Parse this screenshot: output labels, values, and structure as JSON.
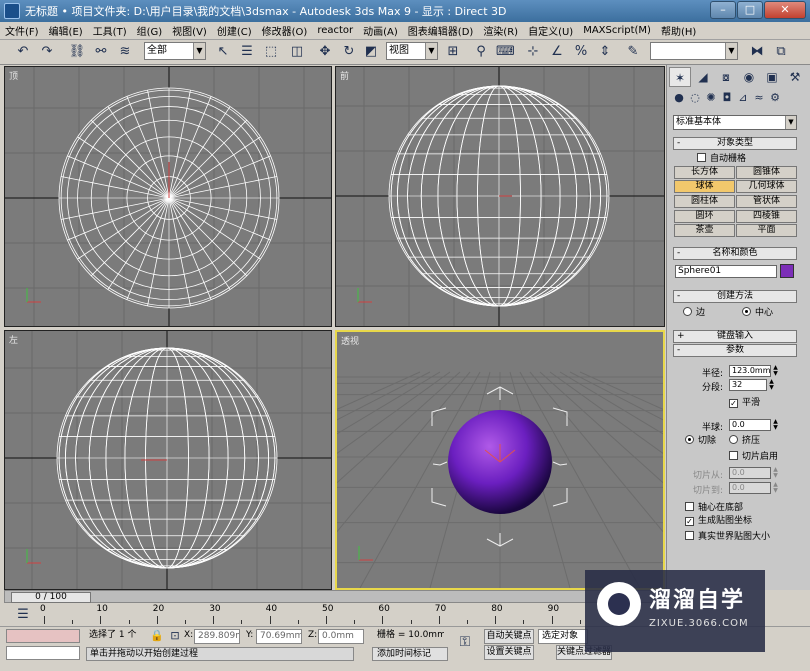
{
  "window": {
    "title": "无标题    • 项目文件夹: D:\\用户目录\\我的文档\\3dsmax    - Autodesk 3ds Max 9    - 显示 : Direct 3D",
    "minimize": "–",
    "maximize": "□",
    "close": "✕"
  },
  "menu": [
    "文件(F)",
    "编辑(E)",
    "工具(T)",
    "组(G)",
    "视图(V)",
    "创建(C)",
    "修改器(O)",
    "reactor",
    "动画(A)",
    "图表编辑器(D)",
    "渲染(R)",
    "自定义(U)",
    "MAXScript(M)",
    "帮助(H)"
  ],
  "toolbar": {
    "selection_filter": "全部",
    "coord_system": "视图",
    "named_selection": ""
  },
  "viewports": {
    "top": "顶",
    "front": "前",
    "left": "左",
    "perspective": "透视"
  },
  "command_panel": {
    "category": "标准基本体",
    "object_type_title": "对象类型",
    "autogrid": "自动栅格",
    "objects": [
      "长方体",
      "圆锥体",
      "球体",
      "几何球体",
      "圆柱体",
      "管状体",
      "圆环",
      "四棱锥",
      "茶壶",
      "平面"
    ],
    "selected_object": "球体",
    "name_color_title": "名称和颜色",
    "object_name": "Sphere01",
    "object_color": "#7c2fb8",
    "creation_method_title": "创建方法",
    "creation_edge": "边",
    "creation_center": "中心",
    "keyboard_entry_title": "键盘输入",
    "parameters_title": "参数",
    "radius_label": "半径:",
    "radius_value": "123.0mm",
    "segments_label": "分段:",
    "segments_value": "32",
    "smooth_label": "平滑",
    "hemisphere_label": "半球:",
    "hemisphere_value": "0.0",
    "chop_label": "切除",
    "squash_label": "挤压",
    "slice_on_label": "切片启用",
    "slice_from_label": "切片从:",
    "slice_from_value": "0.0",
    "slice_to_label": "切片到:",
    "slice_to_value": "0.0",
    "base_to_pivot_label": "轴心在底部",
    "gen_mapping_label": "生成贴图坐标",
    "real_world_label": "真实世界贴图大小"
  },
  "timeline": {
    "frame_display": "0 / 100",
    "ticks": [
      "0",
      "10",
      "20",
      "30",
      "40",
      "50",
      "60",
      "70",
      "80",
      "90"
    ]
  },
  "status": {
    "selected": "选择了 1 个",
    "x_label": "X:",
    "x_value": "289.809mm",
    "y_label": "Y:",
    "y_value": "70.69mm",
    "z_label": "Z:",
    "z_value": "0.0mm",
    "grid": "栅格 = 10.0mm",
    "auto_key": "自动关键点",
    "selected_object": "选定对象",
    "set_key": "设置关键点",
    "key_filters": "关键点过滤器",
    "prompt": "单击并拖动以开始创建过程",
    "add_time_tag": "添加时间标记"
  },
  "watermark": {
    "title": "溜溜自学",
    "url": "ZIXUE.3066.COM"
  }
}
